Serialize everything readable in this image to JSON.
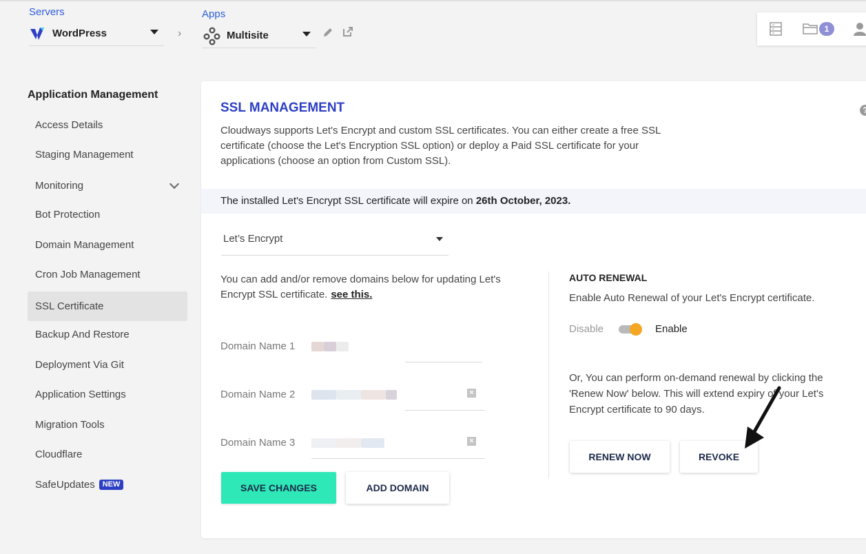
{
  "header": {
    "servers_label": "Servers",
    "server_name": "WordPress",
    "apps_label": "Apps",
    "app_name": "Multisite",
    "notification_count": "1"
  },
  "sidebar": {
    "title": "Application Management",
    "items": [
      {
        "label": "Access Details"
      },
      {
        "label": "Staging Management"
      },
      {
        "label": "Monitoring"
      },
      {
        "label": "Bot Protection"
      },
      {
        "label": "Domain Management"
      },
      {
        "label": "Cron Job Management"
      },
      {
        "label": "SSL Certificate",
        "active": true
      },
      {
        "label": "Backup And Restore"
      },
      {
        "label": "Deployment Via Git"
      },
      {
        "label": "Application Settings"
      },
      {
        "label": "Migration Tools"
      },
      {
        "label": "Cloudflare"
      },
      {
        "label": "SafeUpdates",
        "badge": "NEW"
      }
    ]
  },
  "ssl": {
    "title": "SSL MANAGEMENT",
    "description": "Cloudways supports Let's Encrypt and custom SSL certificates. You can either create a free SSL certificate (choose the Let's Encryption SSL option) or deploy a Paid SSL certificate for your applications (choose an option from Custom SSL).",
    "notice_prefix": "The installed Let's Encrypt SSL certificate will expire on ",
    "notice_date": "26th October, 2023.",
    "type_selected": "Let’s Encrypt",
    "domains_help": "You can add and/or remove domains below for updating Let's Encrypt SSL certificate.",
    "see_this": "see this.",
    "domain_labels": [
      "Domain Name 1",
      "Domain Name 2",
      "Domain Name 3"
    ],
    "save_button": "SAVE CHANGES",
    "add_domain_button": "ADD DOMAIN"
  },
  "auto_renewal": {
    "title": "AUTO RENEWAL",
    "description": "Enable Auto Renewal of your Let's Encrypt certificate.",
    "off_label": "Disable",
    "on_label": "Enable",
    "enabled": true,
    "ondemand_text": "Or, You can perform on-demand renewal by clicking the 'Renew Now' below. This will extend expiry of your Let's Encrypt certificate to 90 days.",
    "renew_button": "RENEW NOW",
    "revoke_button": "REVOKE"
  },
  "colors": {
    "brand_blue": "#2d3fc4",
    "primary_button": "#2ee8b7",
    "toggle_knob": "#f5a623"
  }
}
